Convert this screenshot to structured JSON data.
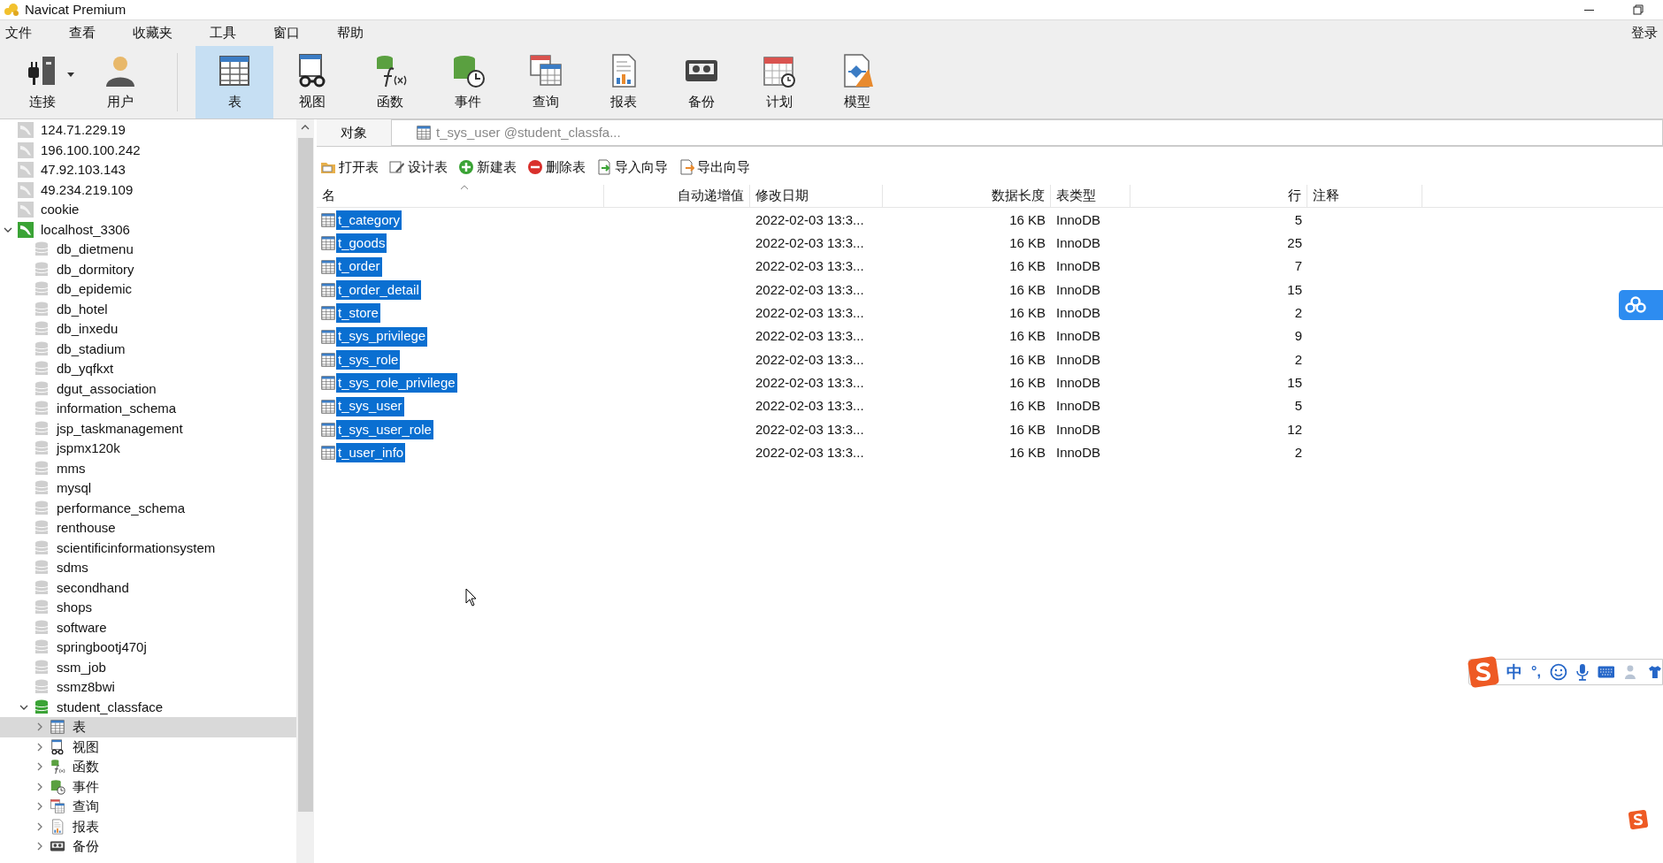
{
  "window": {
    "title": "Navicat Premium"
  },
  "menu": [
    "文件",
    "查看",
    "收藏夹",
    "工具",
    "窗口",
    "帮助"
  ],
  "login": "登录",
  "toolbar": [
    {
      "kind": "connection",
      "label": "连接",
      "dropdown": true,
      "selected": false
    },
    {
      "kind": "user",
      "label": "用户",
      "selected": false
    },
    {
      "kind": "table",
      "label": "表",
      "selected": true
    },
    {
      "kind": "view",
      "label": "视图",
      "selected": false
    },
    {
      "kind": "function",
      "label": "函数",
      "selected": false
    },
    {
      "kind": "event",
      "label": "事件",
      "selected": false
    },
    {
      "kind": "query",
      "label": "查询",
      "selected": false
    },
    {
      "kind": "report",
      "label": "报表",
      "selected": false
    },
    {
      "kind": "backup",
      "label": "备份",
      "selected": false
    },
    {
      "kind": "schedule",
      "label": "计划",
      "selected": false
    },
    {
      "kind": "model",
      "label": "模型",
      "selected": false
    }
  ],
  "sidebar": {
    "items": [
      {
        "kind": "connection",
        "label": "124.71.229.19",
        "active": false,
        "selected": false
      },
      {
        "kind": "connection",
        "label": "196.100.100.242",
        "active": false,
        "selected": false
      },
      {
        "kind": "connection",
        "label": "47.92.103.143",
        "active": false,
        "selected": false
      },
      {
        "kind": "connection",
        "label": "49.234.219.109",
        "active": false,
        "selected": false
      },
      {
        "kind": "connection",
        "label": "cookie",
        "active": false,
        "selected": false
      },
      {
        "kind": "connection",
        "label": "localhost_3306",
        "active": true,
        "expanded": true,
        "selected": false,
        "children": [
          {
            "kind": "database",
            "label": "db_dietmenu",
            "active": false,
            "selected": false
          },
          {
            "kind": "database",
            "label": "db_dormitory",
            "active": false,
            "selected": false
          },
          {
            "kind": "database",
            "label": "db_epidemic",
            "active": false,
            "selected": false
          },
          {
            "kind": "database",
            "label": "db_hotel",
            "active": false,
            "selected": false
          },
          {
            "kind": "database",
            "label": "db_inxedu",
            "active": false,
            "selected": false
          },
          {
            "kind": "database",
            "label": "db_stadium",
            "active": false,
            "selected": false
          },
          {
            "kind": "database",
            "label": "db_yqfkxt",
            "active": false,
            "selected": false
          },
          {
            "kind": "database",
            "label": "dgut_association",
            "active": false,
            "selected": false
          },
          {
            "kind": "database",
            "label": "information_schema",
            "active": false,
            "selected": false
          },
          {
            "kind": "database",
            "label": "jsp_taskmanagement",
            "active": false,
            "selected": false
          },
          {
            "kind": "database",
            "label": "jspmx120k",
            "active": false,
            "selected": false
          },
          {
            "kind": "database",
            "label": "mms",
            "active": false,
            "selected": false
          },
          {
            "kind": "database",
            "label": "mysql",
            "active": false,
            "selected": false
          },
          {
            "kind": "database",
            "label": "performance_schema",
            "active": false,
            "selected": false
          },
          {
            "kind": "database",
            "label": "renthouse",
            "active": false,
            "selected": false
          },
          {
            "kind": "database",
            "label": "scientificinformationsystem",
            "active": false,
            "selected": false
          },
          {
            "kind": "database",
            "label": "sdms",
            "active": false,
            "selected": false
          },
          {
            "kind": "database",
            "label": "secondhand",
            "active": false,
            "selected": false
          },
          {
            "kind": "database",
            "label": "shops",
            "active": false,
            "selected": false
          },
          {
            "kind": "database",
            "label": "software",
            "active": false,
            "selected": false
          },
          {
            "kind": "database",
            "label": "springbootj470j",
            "active": false,
            "selected": false
          },
          {
            "kind": "database",
            "label": "ssm_job",
            "active": false,
            "selected": false
          },
          {
            "kind": "database",
            "label": "ssmz8bwi",
            "active": false,
            "selected": false
          },
          {
            "kind": "database",
            "label": "student_classface",
            "active": true,
            "expanded": true,
            "selected": false,
            "children": [
              {
                "kind": "table",
                "label": "表",
                "expanded": false,
                "selected": true
              },
              {
                "kind": "view",
                "label": "视图",
                "expanded": false,
                "selected": false
              },
              {
                "kind": "function",
                "label": "函数",
                "expanded": false,
                "selected": false
              },
              {
                "kind": "event",
                "label": "事件",
                "expanded": false,
                "selected": false
              },
              {
                "kind": "query",
                "label": "查询",
                "expanded": false,
                "selected": false
              },
              {
                "kind": "report",
                "label": "报表",
                "expanded": false,
                "selected": false
              },
              {
                "kind": "backup",
                "label": "备份",
                "expanded": false,
                "selected": false
              }
            ]
          }
        ]
      }
    ]
  },
  "tabs": [
    {
      "kind": "objects",
      "label": "对象",
      "selected": true
    },
    {
      "kind": "table",
      "label": "t_sys_user @student_classfa...",
      "selected": false
    }
  ],
  "object_toolbar": [
    {
      "kind": "open",
      "label": "打开表"
    },
    {
      "kind": "design",
      "label": "设计表"
    },
    {
      "kind": "new",
      "label": "新建表"
    },
    {
      "kind": "delete",
      "label": "删除表"
    },
    {
      "kind": "import",
      "label": "导入向导"
    },
    {
      "kind": "export",
      "label": "导出向导"
    }
  ],
  "table": {
    "columns": [
      {
        "label": "名",
        "sorted": true
      },
      {
        "label": "自动递增值",
        "sorted": false
      },
      {
        "label": "修改日期",
        "sorted": false
      },
      {
        "label": "数据长度",
        "sorted": false
      },
      {
        "label": "表类型",
        "sorted": false
      },
      {
        "label": "行",
        "sorted": false
      },
      {
        "label": "注释",
        "sorted": false
      }
    ],
    "rows": [
      {
        "selected": true,
        "cells": [
          "t_category",
          "",
          "2022-02-03 13:3...",
          "16 KB",
          "InnoDB",
          "5",
          ""
        ]
      },
      {
        "selected": true,
        "cells": [
          "t_goods",
          "",
          "2022-02-03 13:3...",
          "16 KB",
          "InnoDB",
          "25",
          ""
        ]
      },
      {
        "selected": true,
        "cells": [
          "t_order",
          "",
          "2022-02-03 13:3...",
          "16 KB",
          "InnoDB",
          "7",
          ""
        ]
      },
      {
        "selected": true,
        "cells": [
          "t_order_detail",
          "",
          "2022-02-03 13:3...",
          "16 KB",
          "InnoDB",
          "15",
          ""
        ]
      },
      {
        "selected": true,
        "cells": [
          "t_store",
          "",
          "2022-02-03 13:3...",
          "16 KB",
          "InnoDB",
          "2",
          ""
        ]
      },
      {
        "selected": true,
        "cells": [
          "t_sys_privilege",
          "",
          "2022-02-03 13:3...",
          "16 KB",
          "InnoDB",
          "9",
          ""
        ]
      },
      {
        "selected": true,
        "cells": [
          "t_sys_role",
          "",
          "2022-02-03 13:3...",
          "16 KB",
          "InnoDB",
          "2",
          ""
        ]
      },
      {
        "selected": true,
        "cells": [
          "t_sys_role_privilege",
          "",
          "2022-02-03 13:3...",
          "16 KB",
          "InnoDB",
          "15",
          ""
        ]
      },
      {
        "selected": true,
        "cells": [
          "t_sys_user",
          "",
          "2022-02-03 13:3...",
          "16 KB",
          "InnoDB",
          "5",
          ""
        ]
      },
      {
        "selected": true,
        "cells": [
          "t_sys_user_role",
          "",
          "2022-02-03 13:3...",
          "16 KB",
          "InnoDB",
          "12",
          ""
        ]
      },
      {
        "selected": true,
        "cells": [
          "t_user_info",
          "",
          "2022-02-03 13:3...",
          "16 KB",
          "InnoDB",
          "2",
          ""
        ]
      }
    ]
  },
  "ime_toolbar": {
    "mode": "中",
    "punctuation": "°,"
  }
}
